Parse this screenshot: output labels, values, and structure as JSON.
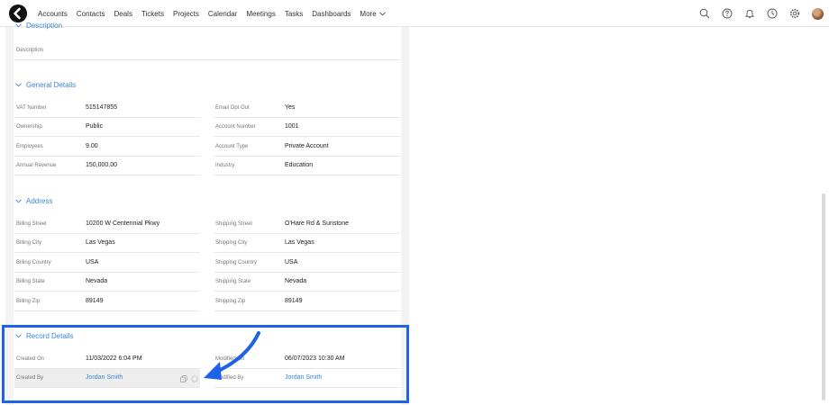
{
  "topbar": {
    "nav": [
      "Accounts",
      "Contacts",
      "Deals",
      "Tickets",
      "Projects",
      "Calendar",
      "Meetings",
      "Tasks",
      "Dashboards"
    ],
    "more_label": "More"
  },
  "sections": {
    "description": {
      "title": "Description",
      "label": "Description"
    },
    "general": {
      "title": "General Details",
      "vat_label": "VAT Number",
      "vat_value": "515147855",
      "ownership_label": "Ownership",
      "ownership_value": "Public",
      "employees_label": "Employees",
      "employees_value": "9.00",
      "revenue_label": "Annual Revenue",
      "revenue_value": "150,000.00",
      "email_opt_label": "Email Opt Out",
      "email_opt_value": "Yes",
      "acct_num_label": "Account Number",
      "acct_num_value": "1001",
      "acct_type_label": "Account Type",
      "acct_type_value": "Private Account",
      "industry_label": "Industry",
      "industry_value": "Education"
    },
    "address": {
      "title": "Address",
      "b_street_label": "Billing Street",
      "b_street_value": "10200 W Centennial Pkwy",
      "b_city_label": "Billing City",
      "b_city_value": "Las Vegas",
      "b_country_label": "Billing Country",
      "b_country_value": "USA",
      "b_state_label": "Billing State",
      "b_state_value": "Nevada",
      "b_zip_label": "Billing Zip",
      "b_zip_value": "89149",
      "s_street_label": "Shipping Street",
      "s_street_value": "O'Hare Rd & Sunstone",
      "s_city_label": "Shipping City",
      "s_city_value": "Las Vegas",
      "s_country_label": "Shipping Country",
      "s_country_value": "USA",
      "s_state_label": "Shipping State",
      "s_state_value": "Nevada",
      "s_zip_label": "Shipping Zip",
      "s_zip_value": "89149"
    },
    "record": {
      "title": "Record Details",
      "created_on_label": "Created On",
      "created_on_value": "11/03/2022 6:04 PM",
      "created_by_label": "Created By",
      "created_by_value": "Jordan Smith",
      "modified_on_label": "Modified On",
      "modified_on_value": "06/07/2023 10:30 AM",
      "modified_by_label": "Modified By",
      "modified_by_value": "Jordan Smith"
    }
  },
  "colors": {
    "accent": "#3a86d9",
    "highlight": "#1f62e6"
  }
}
